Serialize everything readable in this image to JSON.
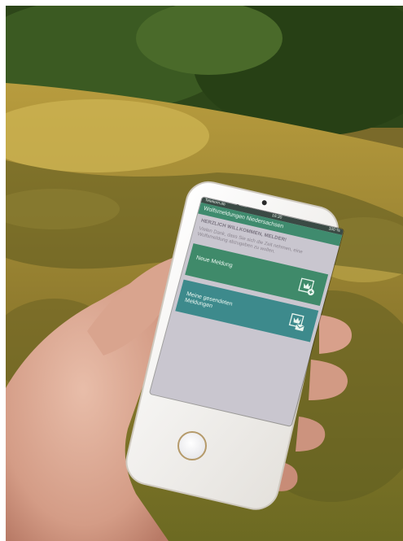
{
  "scene": {
    "description_colors": {
      "grass_light": "#c9b04a",
      "grass_dark": "#6f6a24",
      "shadow": "#4b4a1e",
      "hedge": "#2f4a1c",
      "phone_body": "#f3f1ee",
      "skin": "#d9a895"
    }
  },
  "phone_screen": {
    "status": {
      "carrier": "Telekom.de",
      "time": "16:30",
      "battery": "100 %"
    },
    "app_title": "Wolfsmeldungen Niedersachsen",
    "welcome_heading": "HERZLICH WILLKOMMEN, MELDER!",
    "welcome_text": "Vielen Dank, dass Sie sich die Zeit nehmen, eine Wolfsmeldung abzugeben zu wollen.",
    "tiles": [
      {
        "label": "Neue Meldung",
        "icon": "new-report-icon",
        "color": "#3f8a6a"
      },
      {
        "label": "Meine gesendeten Meldungen",
        "icon": "sent-reports-icon",
        "color": "#3d8a8c"
      }
    ]
  }
}
